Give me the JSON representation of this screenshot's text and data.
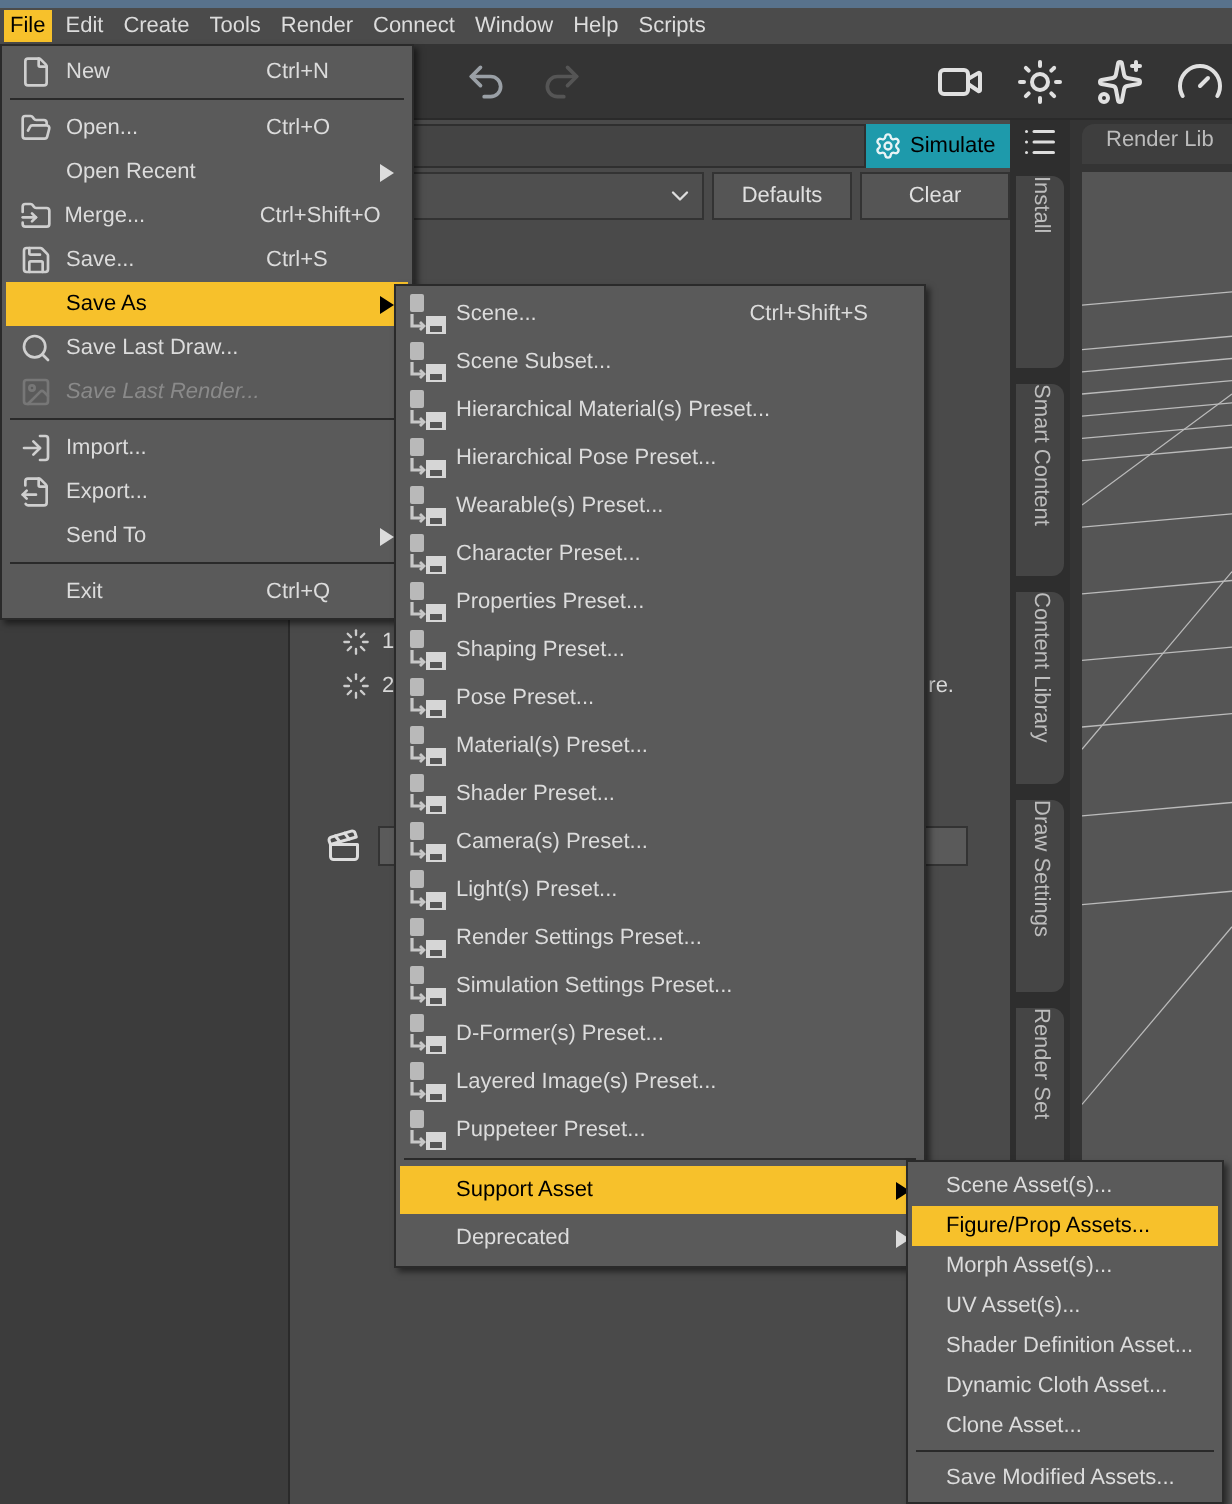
{
  "menubar": [
    {
      "label": "File",
      "selected": true
    },
    {
      "label": "Edit",
      "selected": false
    },
    {
      "label": "Create",
      "selected": false
    },
    {
      "label": "Tools",
      "selected": false
    },
    {
      "label": "Render",
      "selected": false
    },
    {
      "label": "Connect",
      "selected": false
    },
    {
      "label": "Window",
      "selected": false
    },
    {
      "label": "Help",
      "selected": false
    },
    {
      "label": "Scripts",
      "selected": false
    }
  ],
  "pane": {
    "simulate_button": "Simulate",
    "defaults_button": "Defaults",
    "clear_button": "Clear",
    "fragments": [
      "1",
      "2",
      "re."
    ]
  },
  "side_tabs": [
    "Install",
    "Smart Content",
    "Content Library",
    "Draw Settings",
    "Render Set"
  ],
  "viewport_tab": "Render Lib",
  "file_menu": {
    "groups": [
      [
        {
          "label": "New",
          "shortcut": "Ctrl+N",
          "submenu": false,
          "selected": false,
          "disabled": false
        }
      ],
      [
        {
          "label": "Open...",
          "shortcut": "Ctrl+O",
          "submenu": false,
          "selected": false,
          "disabled": false
        },
        {
          "label": "Open Recent",
          "submenu": true,
          "selected": false,
          "disabled": false
        },
        {
          "label": "Merge...",
          "shortcut": "Ctrl+Shift+O",
          "submenu": false,
          "selected": false,
          "disabled": false
        },
        {
          "label": "Save...",
          "shortcut": "Ctrl+S",
          "submenu": false,
          "selected": false,
          "disabled": false
        },
        {
          "label": "Save As",
          "submenu": true,
          "selected": true,
          "disabled": false
        },
        {
          "label": "Save Last Draw...",
          "submenu": false,
          "selected": false,
          "disabled": false
        },
        {
          "label": "Save Last Render...",
          "submenu": false,
          "selected": false,
          "disabled": true
        }
      ],
      [
        {
          "label": "Import...",
          "submenu": false,
          "selected": false,
          "disabled": false
        },
        {
          "label": "Export...",
          "submenu": false,
          "selected": false,
          "disabled": false
        },
        {
          "label": "Send To",
          "submenu": true,
          "selected": false,
          "disabled": false
        }
      ],
      [
        {
          "label": "Exit",
          "shortcut": "Ctrl+Q",
          "submenu": false,
          "selected": false,
          "disabled": false
        }
      ]
    ]
  },
  "save_as_menu": {
    "groups": [
      [
        {
          "label": "Scene...",
          "shortcut": "Ctrl+Shift+S",
          "submenu": false,
          "selected": false
        },
        {
          "label": "Scene Subset...",
          "submenu": false,
          "selected": false
        },
        {
          "label": "Hierarchical Material(s) Preset...",
          "submenu": false,
          "selected": false
        },
        {
          "label": "Hierarchical Pose Preset...",
          "submenu": false,
          "selected": false
        },
        {
          "label": "Wearable(s) Preset...",
          "submenu": false,
          "selected": false
        },
        {
          "label": "Character Preset...",
          "submenu": false,
          "selected": false
        },
        {
          "label": "Properties Preset...",
          "submenu": false,
          "selected": false
        },
        {
          "label": "Shaping Preset...",
          "submenu": false,
          "selected": false
        },
        {
          "label": "Pose Preset...",
          "submenu": false,
          "selected": false
        },
        {
          "label": "Material(s) Preset...",
          "submenu": false,
          "selected": false
        },
        {
          "label": "Shader Preset...",
          "submenu": false,
          "selected": false
        },
        {
          "label": "Camera(s) Preset...",
          "submenu": false,
          "selected": false
        },
        {
          "label": "Light(s) Preset...",
          "submenu": false,
          "selected": false
        },
        {
          "label": "Render Settings Preset...",
          "submenu": false,
          "selected": false
        },
        {
          "label": "Simulation Settings Preset...",
          "submenu": false,
          "selected": false
        },
        {
          "label": "D-Former(s) Preset...",
          "submenu": false,
          "selected": false
        },
        {
          "label": "Layered Image(s) Preset...",
          "submenu": false,
          "selected": false
        },
        {
          "label": "Puppeteer Preset...",
          "submenu": false,
          "selected": false
        }
      ],
      [
        {
          "label": "Support Asset",
          "submenu": true,
          "selected": true
        },
        {
          "label": "Deprecated",
          "submenu": true,
          "selected": false
        }
      ]
    ]
  },
  "support_asset_menu": {
    "groups": [
      [
        {
          "label": "Scene Asset(s)...",
          "selected": false
        },
        {
          "label": "Figure/Prop Assets...",
          "selected": true
        },
        {
          "label": "Morph Asset(s)...",
          "selected": false
        },
        {
          "label": "UV Asset(s)...",
          "selected": false
        },
        {
          "label": "Shader Definition Asset...",
          "selected": false
        },
        {
          "label": "Dynamic Cloth Asset...",
          "selected": false
        },
        {
          "label": "Clone Asset...",
          "selected": false
        }
      ],
      [
        {
          "label": "Save Modified Assets...",
          "selected": false
        }
      ]
    ]
  }
}
